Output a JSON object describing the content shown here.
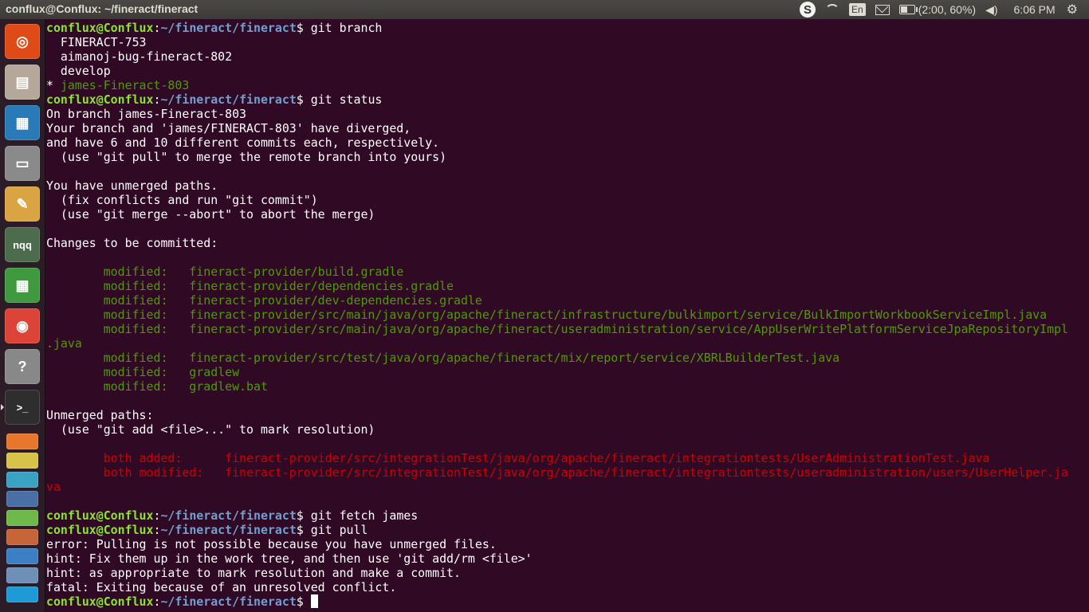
{
  "window": {
    "title": "conflux@Conflux: ~/fineract/fineract"
  },
  "tray": {
    "skype_icon": "skype-icon",
    "keyboard_layout": "En",
    "battery_text": "(2:00, 60%)",
    "battery_level": 0.6,
    "clock": "6:06 PM"
  },
  "launcher": {
    "items": [
      {
        "name": "dash-home",
        "icon": "ubuntu-logo-icon",
        "glyph": "◎",
        "color": "#df4a16"
      },
      {
        "name": "files",
        "icon": "file-cabinet-icon",
        "glyph": "▤",
        "color": "#b5a79a"
      },
      {
        "name": "libreoffice-writer",
        "icon": "writer-document-icon",
        "glyph": "▦",
        "color": "#2a7ab8"
      },
      {
        "name": "disks",
        "icon": "hard-disk-icon",
        "glyph": "▭",
        "color": "#8a8a8a"
      },
      {
        "name": "text-editor",
        "icon": "notepad-icon",
        "glyph": "✎",
        "color": "#d9a441"
      },
      {
        "name": "notepadqq",
        "icon": "nqq-icon",
        "glyph": "nqq",
        "color": "#4d6b4d"
      },
      {
        "name": "libreoffice-calc",
        "icon": "spreadsheet-icon",
        "glyph": "▦",
        "color": "#3f9a3f"
      },
      {
        "name": "chrome",
        "icon": "chrome-icon",
        "glyph": "◉",
        "color": "#db4437"
      },
      {
        "name": "help",
        "icon": "help-icon",
        "glyph": "?",
        "color": "#888888"
      },
      {
        "name": "terminal",
        "icon": "terminal-icon",
        "glyph": ">_",
        "color": "#2e2e2e"
      }
    ],
    "small_items": [
      {
        "name": "pdf-app",
        "icon": "pdf-icon",
        "color": "#e8762c"
      },
      {
        "name": "slack",
        "icon": "slack-icon",
        "color": "#d8c34a"
      },
      {
        "name": "maps-app",
        "icon": "navigation-icon",
        "color": "#3aa3c4"
      },
      {
        "name": "books-app",
        "icon": "books-icon",
        "color": "#4a6fa5"
      },
      {
        "name": "leaf-app",
        "icon": "leaf-icon",
        "color": "#6fb84a"
      },
      {
        "name": "store-app",
        "icon": "store-icon",
        "color": "#c8643a"
      },
      {
        "name": "spotify-app",
        "icon": "music-icon",
        "color": "#3d7fc4"
      },
      {
        "name": "r-studio",
        "icon": "r-icon",
        "color": "#6e8fb8"
      },
      {
        "name": "skype-app",
        "icon": "skype-icon",
        "color": "#1e9ad6"
      }
    ]
  },
  "terminal": {
    "lines": [
      {
        "type": "prompt",
        "user": "conflux@Conflux",
        "sep": ":",
        "path": "~/fineract/fineract",
        "sym": "$ ",
        "cmd": "git branch"
      },
      {
        "type": "out",
        "text": "  FINERACT-753"
      },
      {
        "type": "out",
        "text": "  aimanoj-bug-fineract-802"
      },
      {
        "type": "out",
        "text": "  develop"
      },
      {
        "type": "star",
        "prefix": "* ",
        "text": "james-Fineract-803"
      },
      {
        "type": "prompt",
        "user": "conflux@Conflux",
        "sep": ":",
        "path": "~/fineract/fineract",
        "sym": "$ ",
        "cmd": "git status"
      },
      {
        "type": "out",
        "text": "On branch james-Fineract-803"
      },
      {
        "type": "out",
        "text": "Your branch and 'james/FINERACT-803' have diverged,"
      },
      {
        "type": "out",
        "text": "and have 6 and 10 different commits each, respectively."
      },
      {
        "type": "out",
        "text": "  (use \"git pull\" to merge the remote branch into yours)"
      },
      {
        "type": "out",
        "text": ""
      },
      {
        "type": "out",
        "text": "You have unmerged paths."
      },
      {
        "type": "out",
        "text": "  (fix conflicts and run \"git commit\")"
      },
      {
        "type": "out",
        "text": "  (use \"git merge --abort\" to abort the merge)"
      },
      {
        "type": "out",
        "text": ""
      },
      {
        "type": "out",
        "text": "Changes to be committed:"
      },
      {
        "type": "out",
        "text": ""
      },
      {
        "type": "green",
        "text": "        modified:   fineract-provider/build.gradle"
      },
      {
        "type": "green",
        "text": "        modified:   fineract-provider/dependencies.gradle"
      },
      {
        "type": "green",
        "text": "        modified:   fineract-provider/dev-dependencies.gradle"
      },
      {
        "type": "green",
        "text": "        modified:   fineract-provider/src/main/java/org/apache/fineract/infrastructure/bulkimport/service/BulkImportWorkbookServiceImpl.java"
      },
      {
        "type": "green",
        "text": "        modified:   fineract-provider/src/main/java/org/apache/fineract/useradministration/service/AppUserWritePlatformServiceJpaRepositoryImpl"
      },
      {
        "type": "green",
        "text": ".java"
      },
      {
        "type": "green",
        "text": "        modified:   fineract-provider/src/test/java/org/apache/fineract/mix/report/service/XBRLBuilderTest.java"
      },
      {
        "type": "green",
        "text": "        modified:   gradlew"
      },
      {
        "type": "green",
        "text": "        modified:   gradlew.bat"
      },
      {
        "type": "out",
        "text": ""
      },
      {
        "type": "out",
        "text": "Unmerged paths:"
      },
      {
        "type": "out",
        "text": "  (use \"git add <file>...\" to mark resolution)"
      },
      {
        "type": "out",
        "text": ""
      },
      {
        "type": "red",
        "text": "        both added:      fineract-provider/src/integrationTest/java/org/apache/fineract/integrationtests/UserAdministrationTest.java"
      },
      {
        "type": "red",
        "text": "        both modified:   fineract-provider/src/integrationTest/java/org/apache/fineract/integrationtests/useradministration/users/UserHelper.ja"
      },
      {
        "type": "red",
        "text": "va"
      },
      {
        "type": "out",
        "text": ""
      },
      {
        "type": "prompt",
        "user": "conflux@Conflux",
        "sep": ":",
        "path": "~/fineract/fineract",
        "sym": "$ ",
        "cmd": "git fetch james"
      },
      {
        "type": "prompt",
        "user": "conflux@Conflux",
        "sep": ":",
        "path": "~/fineract/fineract",
        "sym": "$ ",
        "cmd": "git pull"
      },
      {
        "type": "out",
        "text": "error: Pulling is not possible because you have unmerged files."
      },
      {
        "type": "out",
        "text": "hint: Fix them up in the work tree, and then use 'git add/rm <file>'"
      },
      {
        "type": "out",
        "text": "hint: as appropriate to mark resolution and make a commit."
      },
      {
        "type": "out",
        "text": "fatal: Exiting because of an unresolved conflict."
      },
      {
        "type": "prompt",
        "user": "conflux@Conflux",
        "sep": ":",
        "path": "~/fineract/fineract",
        "sym": "$ ",
        "cmd": "",
        "cursor": true
      }
    ]
  }
}
